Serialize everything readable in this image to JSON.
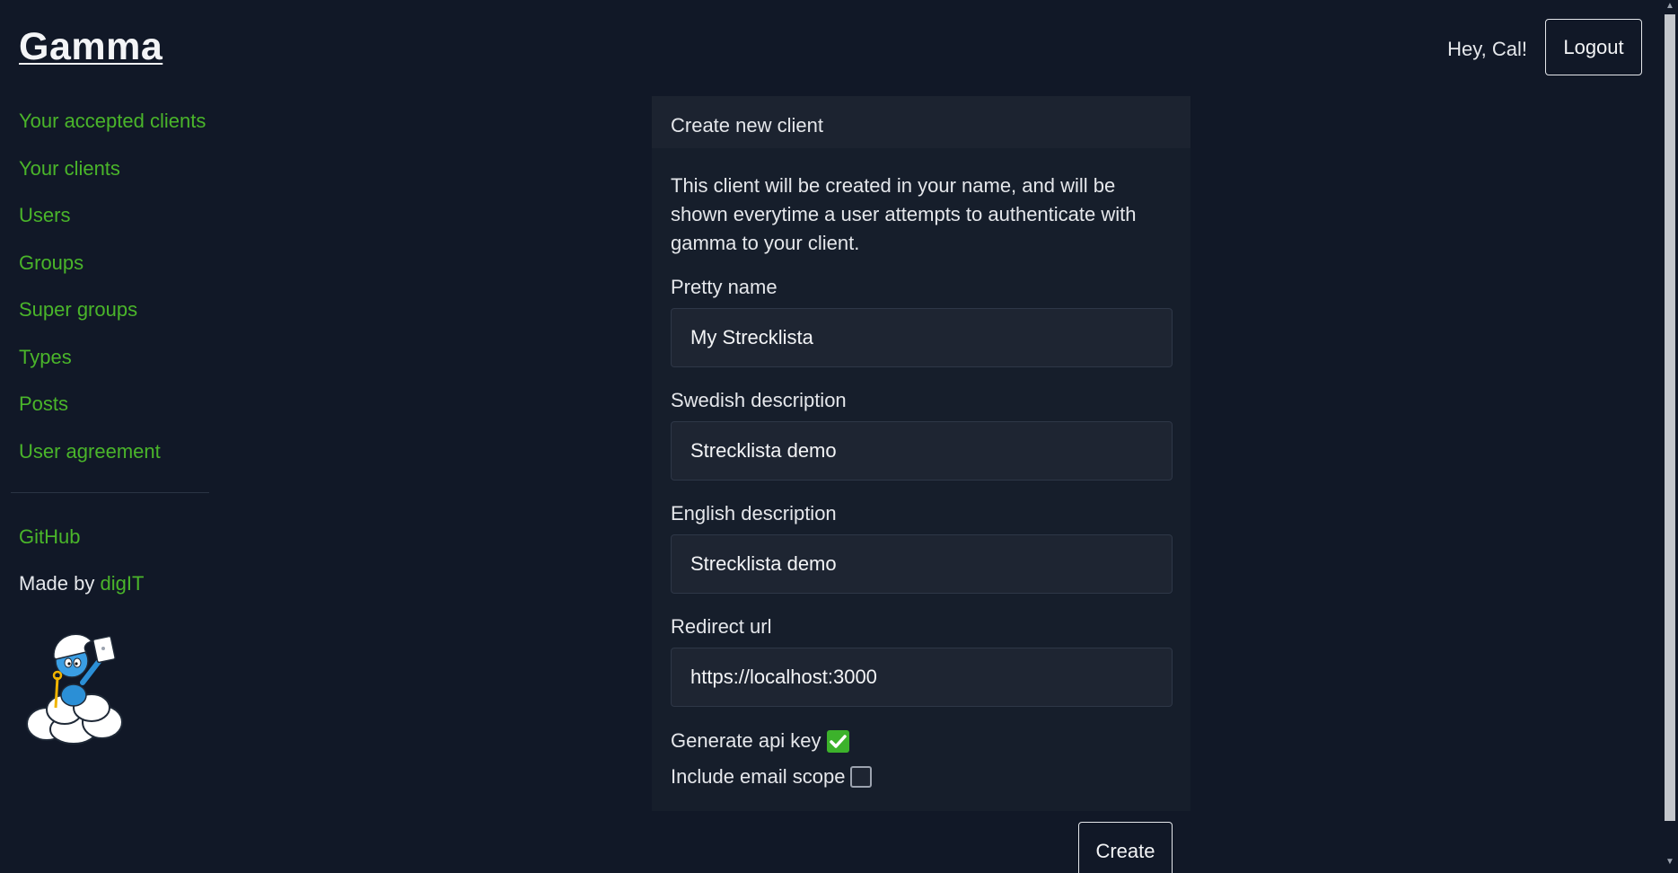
{
  "header": {
    "logo": "Gamma",
    "greeting": "Hey, Cal!",
    "logout_label": "Logout"
  },
  "sidebar": {
    "items": [
      {
        "label": "Your accepted clients"
      },
      {
        "label": "Your clients"
      },
      {
        "label": "Users"
      },
      {
        "label": "Groups"
      },
      {
        "label": "Super groups"
      },
      {
        "label": "Types"
      },
      {
        "label": "Posts"
      },
      {
        "label": "User agreement"
      }
    ],
    "github_label": "GitHub",
    "made_by_prefix": "Made by",
    "made_by_brand": "digIT",
    "mascot_icon": "smurf-on-cloud-mascot"
  },
  "form": {
    "title": "Create new client",
    "description": "This client will be created in your name, and will be shown everytime a user attempts to authenticate with gamma to your client.",
    "fields": [
      {
        "label": "Pretty name",
        "value": "My Strecklista"
      },
      {
        "label": "Swedish description",
        "value": "Strecklista demo"
      },
      {
        "label": "English description",
        "value": "Strecklista demo"
      },
      {
        "label": "Redirect url",
        "value": "https://localhost:3000"
      }
    ],
    "checkboxes": [
      {
        "label": "Generate api key",
        "checked": true
      },
      {
        "label": "Include email scope",
        "checked": false
      }
    ],
    "submit_label": "Create"
  },
  "colors": {
    "background": "#111827",
    "accent_green": "#4ab52a",
    "card": "#161e2b",
    "input": "#1e2532"
  }
}
